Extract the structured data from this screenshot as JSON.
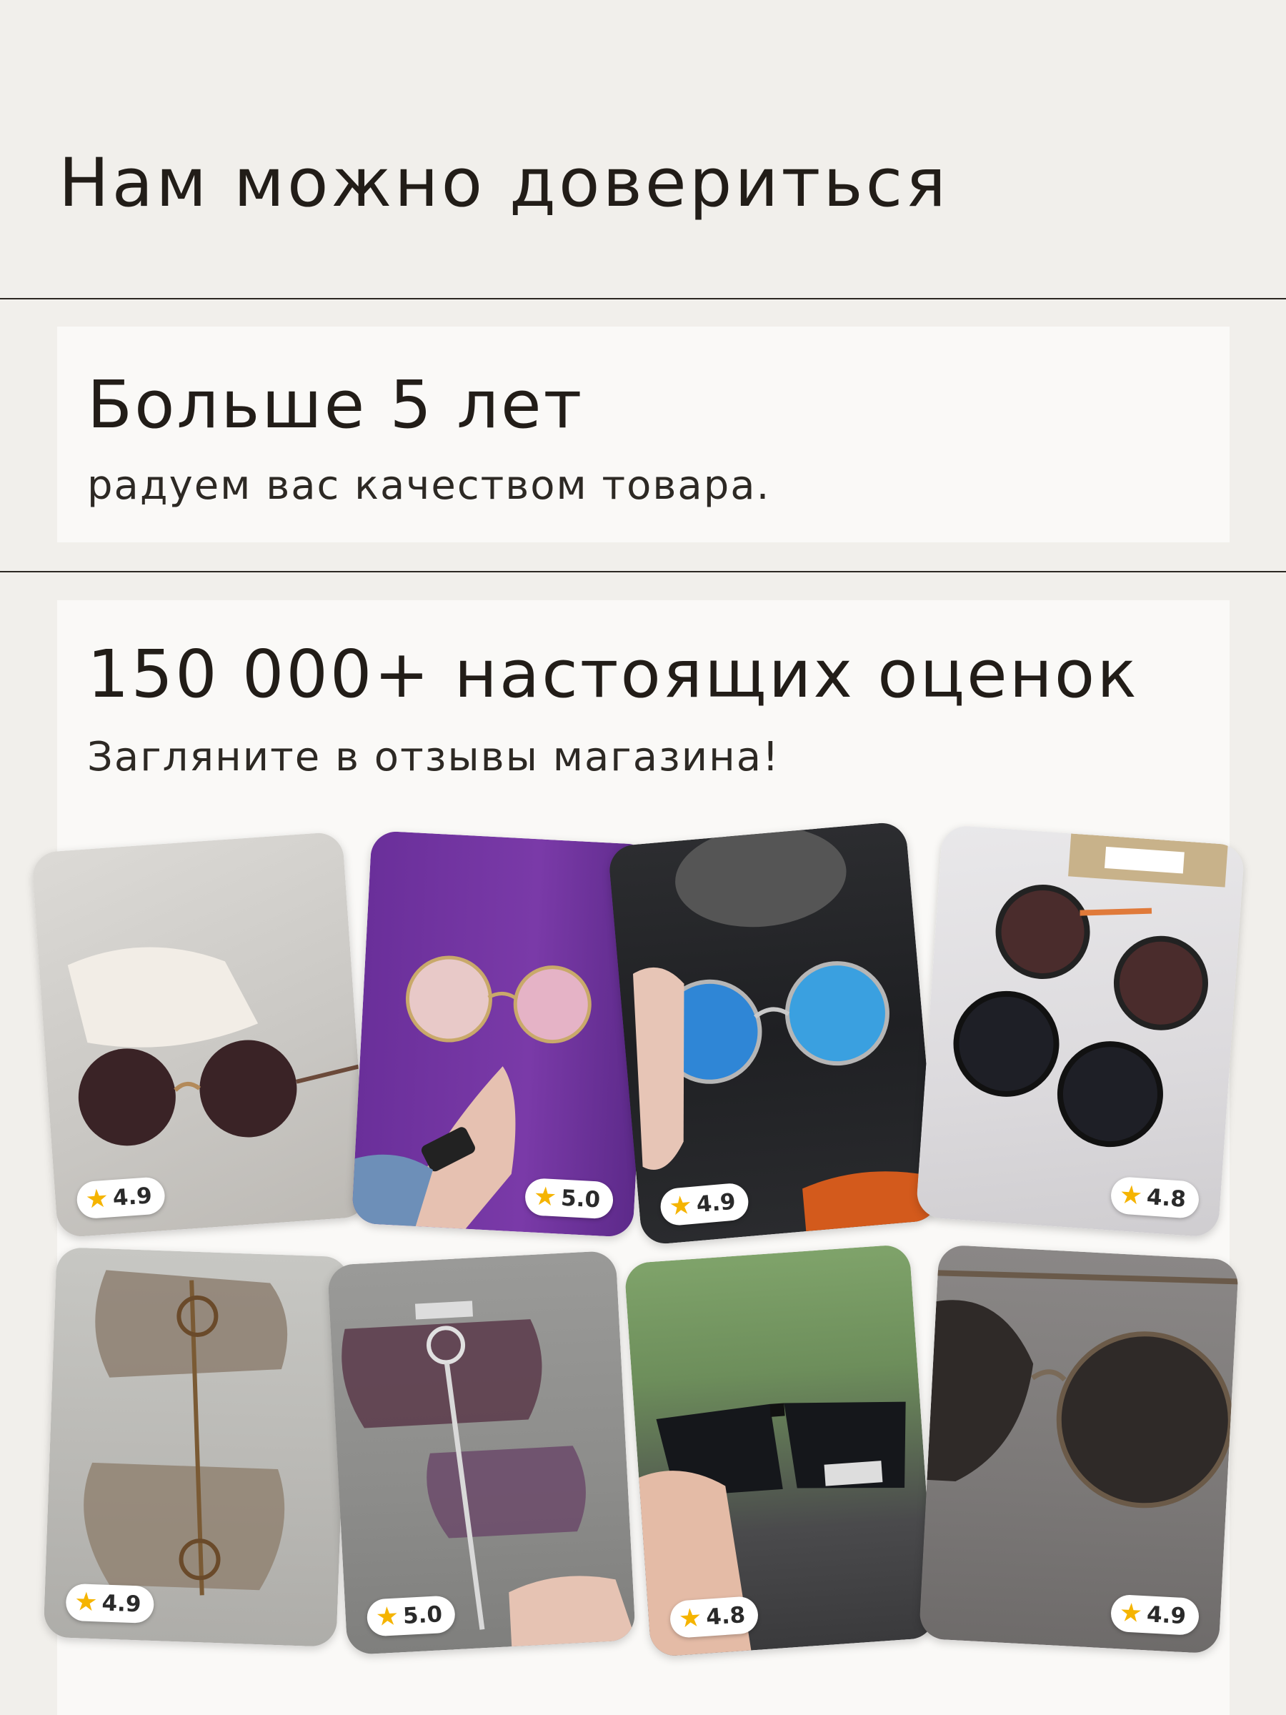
{
  "header": {
    "title": "Нам можно довериться"
  },
  "years_card": {
    "title": "Больше 5 лет",
    "subtitle": "радуем вас качеством товара."
  },
  "reviews_card": {
    "title": "150 000+ настоящих оценок",
    "subtitle": "Загляните в отзывы магазина!"
  },
  "photos": [
    {
      "rating": "4.9",
      "icon": "star-icon"
    },
    {
      "rating": "5.0",
      "icon": "star-icon"
    },
    {
      "rating": "4.9",
      "icon": "star-icon"
    },
    {
      "rating": "4.8",
      "icon": "star-icon"
    },
    {
      "rating": "4.9",
      "icon": "star-icon"
    },
    {
      "rating": "5.0",
      "icon": "star-icon"
    },
    {
      "rating": "4.8",
      "icon": "star-icon"
    },
    {
      "rating": "4.9",
      "icon": "star-icon"
    }
  ],
  "colors": {
    "background": "#f1efeb",
    "card": "#faf9f7",
    "text": "#221d18",
    "star": "#f5b400"
  }
}
